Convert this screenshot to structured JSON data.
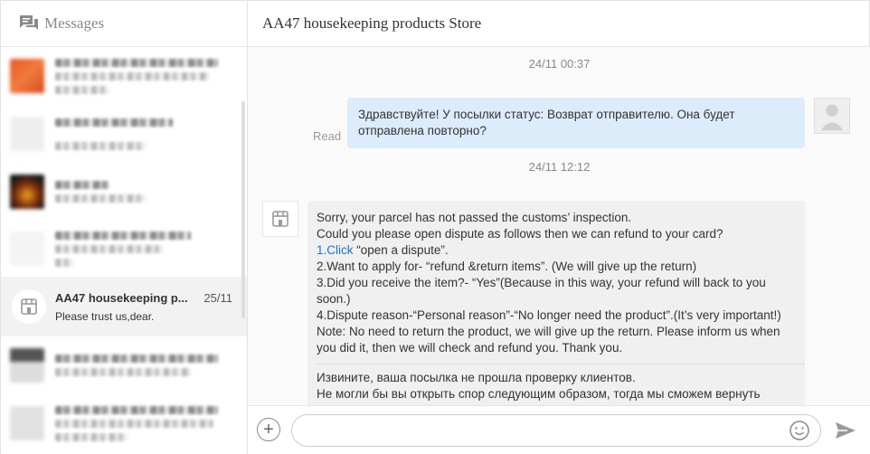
{
  "sidebar": {
    "title": "Messages",
    "active_conversation": {
      "name": "AA47 housekeeping p...",
      "date": "25/11",
      "preview": "Please trust us,dear."
    }
  },
  "chat": {
    "title": "AA47 housekeeping products Store",
    "timestamp_1": "24/11 00:37",
    "read_label": "Read",
    "outgoing_message": "Здравствуйте! У посылки статус: Возврат отправителю. Она будет отправлена повторно?",
    "timestamp_2": "24/11 12:12",
    "incoming": {
      "line1": "Sorry, your parcel has not passed the customs’ inspection.",
      "line2": "Could you please open dispute as follows then we can refund to your card?",
      "line3_link": "1.Click",
      "line3_rest": " “open a dispute”.",
      "line4": "2.Want to apply for- “refund &return items”. (We will give up the return)",
      "line5": "3.Did you receive the item?- “Yes”(Because in this way, your refund will back to you soon.)",
      "line6": "4.Dispute reason-“Personal reason”-“No longer need the product”.(It’s very important!)",
      "line7": "Note: No need to return the product, we will give up the return. Please inform us when you did it, then we will check and refund you. Thank you.",
      "translation_1": "Извините, ваша посылка не прошла проверку клиентов.",
      "translation_2": "Не могли бы вы открыть спор следующим образом, тогда мы сможем вернуть"
    }
  },
  "composer": {
    "placeholder": ""
  },
  "colors": {
    "outgoing_bubble": "#dcecfb",
    "incoming_bubble": "#f0f0f0",
    "link": "#1a73c8",
    "active_conversation_bg": "#f2f2f2"
  },
  "icons": {
    "messages": "chat-bubbles-icon",
    "store": "storefront-icon",
    "user": "user-silhouette-icon",
    "attach": "plus-circle-icon",
    "emoji": "smiley-icon",
    "send": "send-arrow-icon"
  }
}
